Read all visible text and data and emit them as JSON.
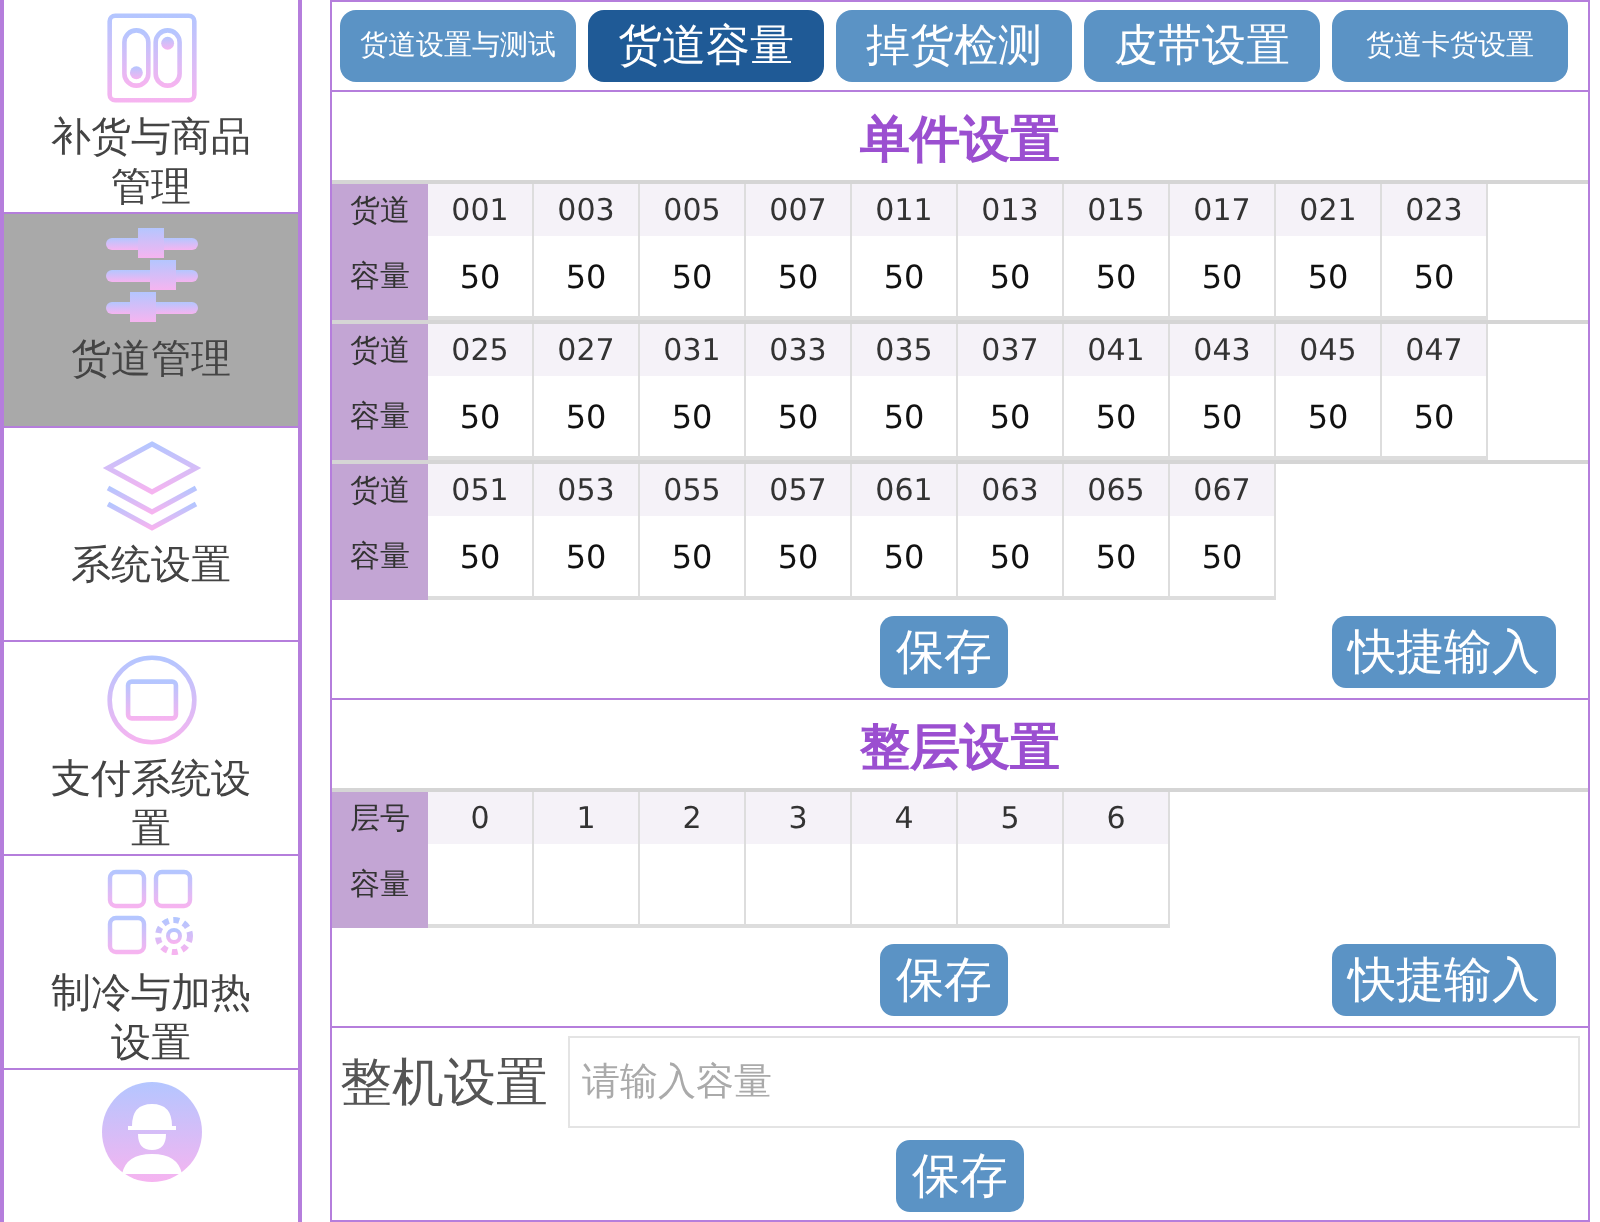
{
  "sidebar": {
    "items": [
      {
        "label": "补货与商品管理",
        "kind": "switch",
        "selected": false
      },
      {
        "label": "货道管理",
        "kind": "sliders",
        "selected": true
      },
      {
        "label": "系统设置",
        "kind": "layers",
        "selected": false
      },
      {
        "label": "支付系统设置",
        "kind": "card",
        "selected": false
      },
      {
        "label": "制冷与加热设置",
        "kind": "grid",
        "selected": false
      },
      {
        "kind": "worker",
        "selected": false
      }
    ]
  },
  "tabs": [
    {
      "label": "货道设置与测试",
      "selected": false
    },
    {
      "label": "货道容量",
      "selected": true
    },
    {
      "label": "掉货检测",
      "selected": false
    },
    {
      "label": "皮带设置",
      "selected": false
    },
    {
      "label": "货道卡货设置",
      "selected": false
    }
  ],
  "single_setting": {
    "title": "单件设置",
    "blocks": [
      {
        "header_label": "货道",
        "value_label": "容量",
        "lanes": [
          {
            "number": "001",
            "capacity": "50"
          },
          {
            "number": "003",
            "capacity": "50"
          },
          {
            "number": "005",
            "capacity": "50"
          },
          {
            "number": "007",
            "capacity": "50"
          },
          {
            "number": "011",
            "capacity": "50"
          },
          {
            "number": "013",
            "capacity": "50"
          },
          {
            "number": "015",
            "capacity": "50"
          },
          {
            "number": "017",
            "capacity": "50"
          },
          {
            "number": "021",
            "capacity": "50"
          },
          {
            "number": "023",
            "capacity": "50"
          }
        ]
      },
      {
        "header_label": "货道",
        "value_label": "容量",
        "lanes": [
          {
            "number": "025",
            "capacity": "50"
          },
          {
            "number": "027",
            "capacity": "50"
          },
          {
            "number": "031",
            "capacity": "50"
          },
          {
            "number": "033",
            "capacity": "50"
          },
          {
            "number": "035",
            "capacity": "50"
          },
          {
            "number": "037",
            "capacity": "50"
          },
          {
            "number": "041",
            "capacity": "50"
          },
          {
            "number": "043",
            "capacity": "50"
          },
          {
            "number": "045",
            "capacity": "50"
          },
          {
            "number": "047",
            "capacity": "50"
          }
        ]
      },
      {
        "header_label": "货道",
        "value_label": "容量",
        "lanes": [
          {
            "number": "051",
            "capacity": "50"
          },
          {
            "number": "053",
            "capacity": "50"
          },
          {
            "number": "055",
            "capacity": "50"
          },
          {
            "number": "057",
            "capacity": "50"
          },
          {
            "number": "061",
            "capacity": "50"
          },
          {
            "number": "063",
            "capacity": "50"
          },
          {
            "number": "065",
            "capacity": "50"
          },
          {
            "number": "067",
            "capacity": "50"
          }
        ]
      }
    ],
    "save_button": "保存",
    "quick_input_button": "快捷输入"
  },
  "layer_setting": {
    "title": "整层设置",
    "header_label": "层号",
    "value_label": "容量",
    "layers": [
      "0",
      "1",
      "2",
      "3",
      "4",
      "5",
      "6"
    ],
    "save_button": "保存",
    "quick_input_button": "快捷输入"
  },
  "whole_machine": {
    "label": "整机设置",
    "placeholder": "请输入容量",
    "save_button": "保存"
  }
}
